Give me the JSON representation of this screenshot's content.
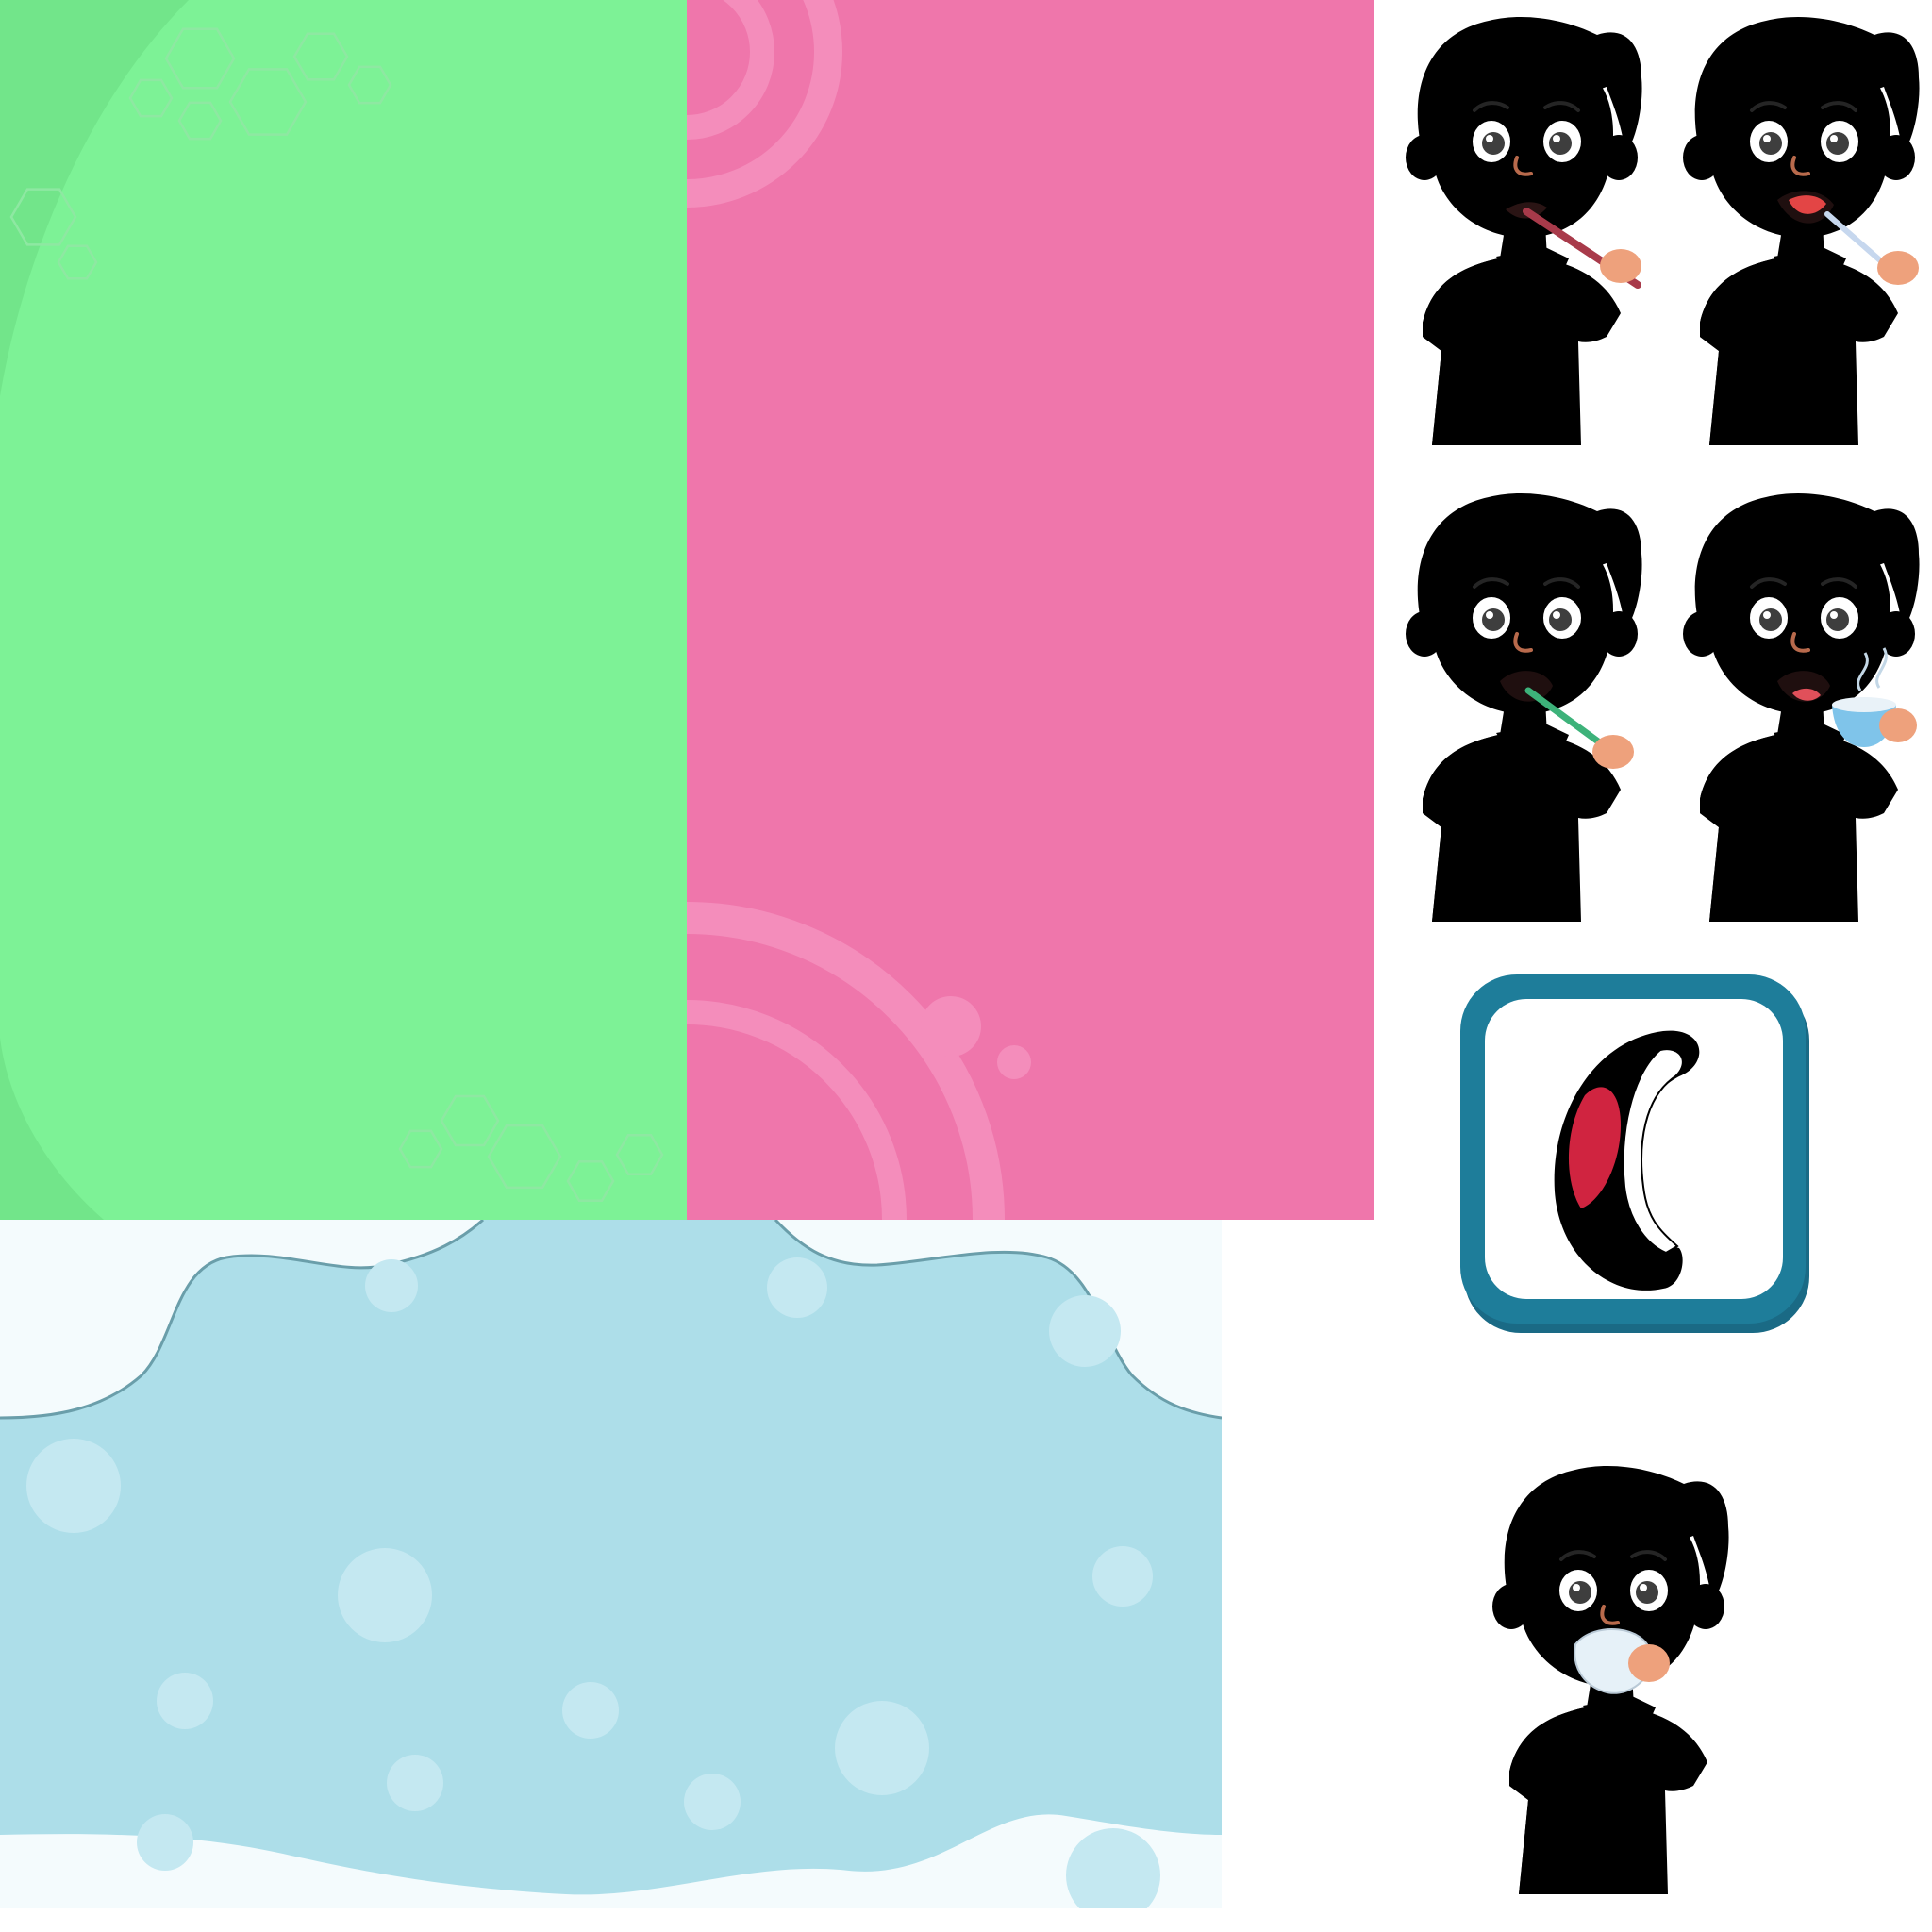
{
  "colors": {
    "green_panel": "#7df296",
    "green_panel_edge": "#72e58a",
    "pink_panel": "#ef76ab",
    "pink_ring": "#f48dbb",
    "blue_panel": "#addee9",
    "blue_bubble": "#c4e8f1",
    "blue_frame_bg": "#f4fbfd",
    "blue_outline": "#6a9eaa",
    "icon_frame": "#1e7d9a",
    "icon_frame_dark": "#1a6a85",
    "skin": "#eea17c",
    "hair": "#252525"
  },
  "panels": [
    {
      "name": "green-panel",
      "pattern": "hexagons"
    },
    {
      "name": "pink-panel",
      "pattern": "rings"
    },
    {
      "name": "blue-panel",
      "pattern": "bubbles"
    }
  ],
  "characters": [
    {
      "name": "boy-green-shirt",
      "shirt": "#62bd63",
      "shirt_dark": "#4a9a4c",
      "collar": "#2f7a3a",
      "action": "tongue-scraper",
      "tool": "#a83a4a"
    },
    {
      "name": "boy-blue-shirt",
      "shirt": "#7ed2e6",
      "shirt_dark": "#62b0c0",
      "collar": "#3b4fa0",
      "action": "oil-brush",
      "tool": "#c6d7ee"
    },
    {
      "name": "boy-pink-shirt",
      "shirt": "#ef5f7c",
      "shirt_dark": "#d24866",
      "collar": "#c2344d",
      "action": "toothbrush",
      "tool": "#3db27a"
    },
    {
      "name": "boy-yellow-shirt",
      "shirt": "#ebd03c",
      "shirt_dark": "#d9b82a",
      "collar": "#c9a420",
      "action": "hot-drink-cup",
      "tool": "#7fc4ea"
    },
    {
      "name": "boy-purple-shirt",
      "shirt": "#c364a9",
      "shirt_dark": "#9b3a86",
      "collar": "#7a2a6a",
      "action": "handkerchief",
      "tool": "#e6f1f8"
    }
  ],
  "icon": {
    "name": "mouth-icon",
    "lip": "#000000",
    "tongue": "#d02440",
    "teeth": "#ffffff"
  }
}
